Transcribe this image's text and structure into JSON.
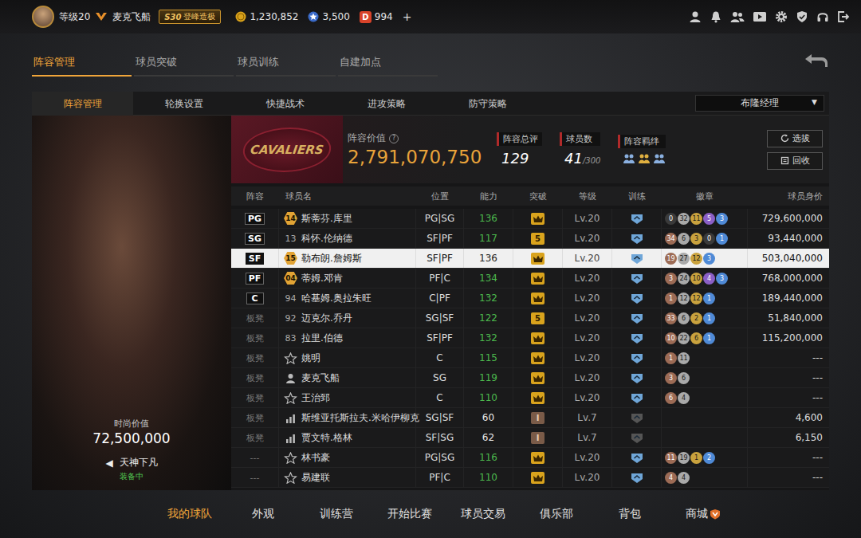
{
  "top_bar": {
    "level": "等级20",
    "player_name": "麦克飞船",
    "season": "S30",
    "rank_title": "登峰造极",
    "currencies": [
      {
        "kind": "coin",
        "value": "1,230,852"
      },
      {
        "kind": "star",
        "value": "3,500"
      },
      {
        "kind": "points",
        "icon": "D",
        "value": "994"
      }
    ],
    "add": "+"
  },
  "sub_tabs": [
    {
      "label": "阵容管理",
      "selected": true
    },
    {
      "label": "球员突破",
      "selected": false
    },
    {
      "label": "球员训练",
      "selected": false
    },
    {
      "label": "自建加点",
      "selected": false
    }
  ],
  "panel_tabs": [
    {
      "label": "阵容管理",
      "selected": true
    },
    {
      "label": "轮换设置",
      "selected": false
    },
    {
      "label": "快捷战术",
      "selected": false
    },
    {
      "label": "进攻策略",
      "selected": false
    },
    {
      "label": "防守策略",
      "selected": false
    }
  ],
  "manager_select": {
    "value": "布隆经理",
    "arrow": "▼"
  },
  "left_card": {
    "fashion_label": "时尚价值",
    "fashion_value": "72,500,000",
    "prev": "◀",
    "outfit": "天神下凡",
    "status": "装备中"
  },
  "summary": {
    "logo_text": "CAVALIERS",
    "value_label": "阵容价值",
    "help": "?",
    "value": "2,791,070,750",
    "rating_label": "阵容总评",
    "rating": "129",
    "count_label": "球员数",
    "count": "41",
    "count_max": "/300",
    "bond_label": "阵容羁绊",
    "buttons": [
      "选拔",
      "回收"
    ]
  },
  "table": {
    "columns": [
      "阵容",
      "球员名",
      "位置",
      "能力",
      "突破",
      "等级",
      "训练",
      "徽章",
      "球员身价"
    ],
    "rows": [
      {
        "slot": "PG",
        "starter": true,
        "tag": {
          "kind": "hex",
          "text": "14"
        },
        "name": "斯蒂芬.库里",
        "position": "PG|SG",
        "ability": "136",
        "ability_color": "#4cb84c",
        "breakthrough": {
          "kind": "crown"
        },
        "level": "Lv.20",
        "training": true,
        "badges": [
          {
            "count": "0",
            "color": "#3a3a3a"
          },
          {
            "count": "32",
            "color": "#a9a9a9"
          },
          {
            "count": "11",
            "color": "#c9a23e"
          },
          {
            "count": "5",
            "color": "#8b5fc6"
          },
          {
            "count": "3",
            "color": "#4f8ad6"
          }
        ],
        "value": "729,600,000",
        "selected": false
      },
      {
        "slot": "SG",
        "starter": true,
        "tag": {
          "kind": "plain",
          "text": "13"
        },
        "name": "科怀.伦纳德",
        "position": "SF|PF",
        "ability": "117",
        "ability_color": "#4cb84c",
        "breakthrough": {
          "kind": "number",
          "text": "5"
        },
        "level": "Lv.20",
        "training": true,
        "badges": [
          {
            "count": "34",
            "color": "#9c6b55"
          },
          {
            "count": "6",
            "color": "#a9a9a9"
          },
          {
            "count": "3",
            "color": "#c9a23e"
          },
          {
            "count": "0",
            "color": "#3a3a3a"
          },
          {
            "count": "1",
            "color": "#4f8ad6"
          }
        ],
        "value": "93,440,000",
        "selected": false
      },
      {
        "slot": "SF",
        "starter": true,
        "tag": {
          "kind": "hex",
          "text": "15"
        },
        "name": "勒布朗.詹姆斯",
        "position": "SF|PF",
        "ability": "136",
        "ability_color": "#222222",
        "breakthrough": {
          "kind": "crown"
        },
        "level": "Lv.20",
        "training": true,
        "badges": [
          {
            "count": "19",
            "color": "#9c6b55"
          },
          {
            "count": "27",
            "color": "#a9a9a9"
          },
          {
            "count": "12",
            "color": "#c9a23e"
          },
          {
            "count": "3",
            "color": "#4f8ad6"
          }
        ],
        "value": "503,040,000",
        "selected": true
      },
      {
        "slot": "PF",
        "starter": true,
        "tag": {
          "kind": "hex",
          "text": "04"
        },
        "name": "蒂姆.邓肯",
        "position": "PF|C",
        "ability": "134",
        "ability_color": "#4cb84c",
        "breakthrough": {
          "kind": "crown"
        },
        "level": "Lv.20",
        "training": true,
        "badges": [
          {
            "count": "3",
            "color": "#9c6b55"
          },
          {
            "count": "24",
            "color": "#a9a9a9"
          },
          {
            "count": "10",
            "color": "#c9a23e"
          },
          {
            "count": "4",
            "color": "#8b5fc6"
          },
          {
            "count": "3",
            "color": "#4f8ad6"
          }
        ],
        "value": "768,000,000",
        "selected": false
      },
      {
        "slot": "C",
        "starter": true,
        "tag": {
          "kind": "plain",
          "text": "94"
        },
        "name": "哈基姆.奥拉朱旺",
        "position": "C|PF",
        "ability": "132",
        "ability_color": "#4cb84c",
        "breakthrough": {
          "kind": "crown"
        },
        "level": "Lv.20",
        "training": true,
        "badges": [
          {
            "count": "1",
            "color": "#9c6b55"
          },
          {
            "count": "12",
            "color": "#a9a9a9"
          },
          {
            "count": "12",
            "color": "#c9a23e"
          },
          {
            "count": "1",
            "color": "#4f8ad6"
          }
        ],
        "value": "189,440,000",
        "selected": false
      },
      {
        "slot": "板凳",
        "starter": false,
        "tag": {
          "kind": "plain",
          "text": "92"
        },
        "name": "迈克尔.乔丹",
        "position": "SG|SF",
        "ability": "122",
        "ability_color": "#4cb84c",
        "breakthrough": {
          "kind": "number",
          "text": "5"
        },
        "level": "Lv.20",
        "training": true,
        "badges": [
          {
            "count": "33",
            "color": "#9c6b55"
          },
          {
            "count": "6",
            "color": "#a9a9a9"
          },
          {
            "count": "2",
            "color": "#c9a23e"
          },
          {
            "count": "1",
            "color": "#4f8ad6"
          }
        ],
        "value": "51,840,000",
        "selected": false
      },
      {
        "slot": "板凳",
        "starter": false,
        "tag": {
          "kind": "plain",
          "text": "83"
        },
        "name": "拉里.伯德",
        "position": "SF|PF",
        "ability": "132",
        "ability_color": "#4cb84c",
        "breakthrough": {
          "kind": "crown"
        },
        "level": "Lv.20",
        "training": true,
        "badges": [
          {
            "count": "10",
            "color": "#9c6b55"
          },
          {
            "count": "22",
            "color": "#a9a9a9"
          },
          {
            "count": "6",
            "color": "#c9a23e"
          },
          {
            "count": "1",
            "color": "#4f8ad6"
          }
        ],
        "value": "115,200,000",
        "selected": false
      },
      {
        "slot": "板凳",
        "starter": false,
        "tag": {
          "kind": "star"
        },
        "name": "姚明",
        "position": "C",
        "ability": "115",
        "ability_color": "#4cb84c",
        "breakthrough": {
          "kind": "crown"
        },
        "level": "Lv.20",
        "training": true,
        "badges": [
          {
            "count": "1",
            "color": "#9c6b55"
          },
          {
            "count": "11",
            "color": "#a9a9a9"
          }
        ],
        "value": "---",
        "selected": false
      },
      {
        "slot": "板凳",
        "starter": false,
        "tag": {
          "kind": "person"
        },
        "name": "麦克飞船",
        "position": "SG",
        "ability": "119",
        "ability_color": "#4cb84c",
        "breakthrough": {
          "kind": "crown"
        },
        "level": "Lv.20",
        "training": true,
        "badges": [
          {
            "count": "3",
            "color": "#9c6b55"
          },
          {
            "count": "6",
            "color": "#a9a9a9"
          }
        ],
        "value": "---",
        "selected": false
      },
      {
        "slot": "板凳",
        "starter": false,
        "tag": {
          "kind": "star"
        },
        "name": "王治郅",
        "position": "C",
        "ability": "110",
        "ability_color": "#4cb84c",
        "breakthrough": {
          "kind": "crown"
        },
        "level": "Lv.20",
        "training": true,
        "badges": [
          {
            "count": "6",
            "color": "#9c6b55"
          },
          {
            "count": "4",
            "color": "#a9a9a9"
          }
        ],
        "value": "---",
        "selected": false
      },
      {
        "slot": "板凳",
        "starter": false,
        "tag": {
          "kind": "bars"
        },
        "name": "斯维亚托斯拉夫.米哈伊柳克",
        "position": "SG|SF",
        "ability": "60",
        "ability_color": "#e8e8e8",
        "breakthrough": {
          "kind": "rank",
          "text": "I"
        },
        "level": "Lv.7",
        "training": false,
        "badges": [],
        "value": "4,600",
        "selected": false
      },
      {
        "slot": "板凳",
        "starter": false,
        "tag": {
          "kind": "bars"
        },
        "name": "贾文特.格林",
        "position": "SF|SG",
        "ability": "62",
        "ability_color": "#e8e8e8",
        "breakthrough": {
          "kind": "rank",
          "text": "I"
        },
        "level": "Lv.7",
        "training": false,
        "badges": [],
        "value": "6,150",
        "selected": false
      },
      {
        "slot": "---",
        "starter": false,
        "tag": {
          "kind": "star"
        },
        "name": "林书豪",
        "position": "PG|SG",
        "ability": "116",
        "ability_color": "#4cb84c",
        "breakthrough": {
          "kind": "crown"
        },
        "level": "Lv.20",
        "training": true,
        "badges": [
          {
            "count": "11",
            "color": "#9c6b55"
          },
          {
            "count": "19",
            "color": "#a9a9a9"
          },
          {
            "count": "1",
            "color": "#c9a23e"
          },
          {
            "count": "2",
            "color": "#4f8ad6"
          }
        ],
        "value": "---",
        "selected": false
      },
      {
        "slot": "---",
        "starter": false,
        "tag": {
          "kind": "star"
        },
        "name": "易建联",
        "position": "PF|C",
        "ability": "110",
        "ability_color": "#4cb84c",
        "breakthrough": {
          "kind": "crown"
        },
        "level": "Lv.20",
        "training": true,
        "badges": [
          {
            "count": "4",
            "color": "#9c6b55"
          },
          {
            "count": "4",
            "color": "#a9a9a9"
          }
        ],
        "value": "---",
        "selected": false
      }
    ]
  },
  "bottom_nav": [
    {
      "label": "我的球队",
      "selected": true
    },
    {
      "label": "外观",
      "selected": false
    },
    {
      "label": "训练营",
      "selected": false
    },
    {
      "label": "开始比赛",
      "selected": false
    },
    {
      "label": "球员交易",
      "selected": false
    },
    {
      "label": "俱乐部",
      "selected": false
    },
    {
      "label": "背包",
      "selected": false
    },
    {
      "label": "商城",
      "selected": false,
      "badge": true
    }
  ]
}
